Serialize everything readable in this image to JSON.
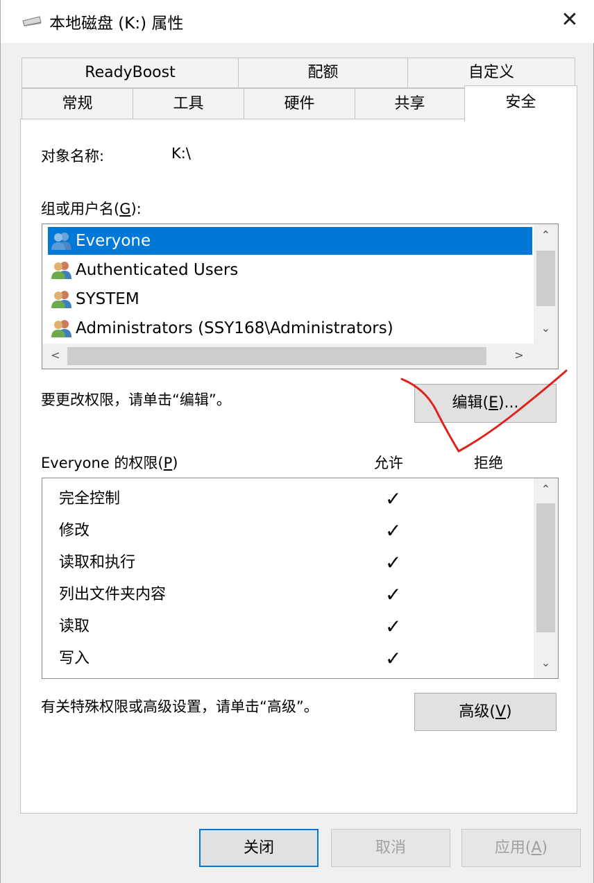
{
  "window": {
    "title": "本地磁盘 (K:) 属性",
    "close_glyph": "✕"
  },
  "tabs": {
    "row1": [
      "ReadyBoost",
      "配额",
      "自定义"
    ],
    "row2": [
      "常规",
      "工具",
      "硬件",
      "共享",
      "安全"
    ],
    "active": "安全"
  },
  "security": {
    "object_name_label": "对象名称:",
    "object_name_value": "K:\\",
    "groups_label_pre": "组或用户名(",
    "groups_label_key": "G",
    "groups_label_post": "):",
    "groups": [
      {
        "name": "Everyone",
        "selected": true
      },
      {
        "name": "Authenticated Users",
        "selected": false
      },
      {
        "name": "SYSTEM",
        "selected": false
      },
      {
        "name": "Administrators (SSY168\\Administrators)",
        "selected": false
      }
    ],
    "edit_hint": "要更改权限，请单击“编辑”。",
    "edit_button_pre": "编辑(",
    "edit_button_key": "E",
    "edit_button_post": ")...",
    "perm_label_pre": "Everyone 的权限(",
    "perm_label_key": "P",
    "perm_label_post": ")",
    "allow_header": "允许",
    "deny_header": "拒绝",
    "permissions": [
      {
        "name": "完全控制",
        "allow": "✓",
        "deny": ""
      },
      {
        "name": "修改",
        "allow": "✓",
        "deny": ""
      },
      {
        "name": "读取和执行",
        "allow": "✓",
        "deny": ""
      },
      {
        "name": "列出文件夹内容",
        "allow": "✓",
        "deny": ""
      },
      {
        "name": "读取",
        "allow": "✓",
        "deny": ""
      },
      {
        "name": "写入",
        "allow": "✓",
        "deny": ""
      }
    ],
    "advanced_hint": "有关特殊权限或高级设置，请单击“高级”。",
    "advanced_button_pre": "高级(",
    "advanced_button_key": "V",
    "advanced_button_post": ")"
  },
  "footer": {
    "close_label": "关闭",
    "cancel_label": "取消",
    "apply_pre": "应用(",
    "apply_key": "A",
    "apply_post": ")"
  },
  "icons": {
    "scroll_up": "⌃",
    "scroll_down": "⌄",
    "scroll_left": "<",
    "scroll_right": ">"
  },
  "colors": {
    "selection": "#0078d7",
    "annotation": "#e0201a"
  }
}
